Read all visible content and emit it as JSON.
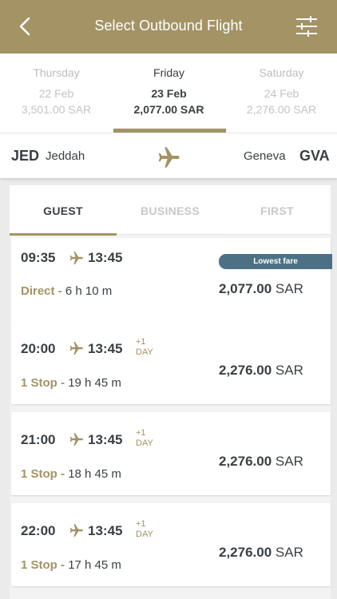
{
  "header": {
    "title": "Select Outbound Flight",
    "back_icon": "chevron-left-icon",
    "filter_icon": "sliders-icon"
  },
  "dates": [
    {
      "day": "Thursday",
      "date": "22 Feb",
      "price": "3,501.00 SAR",
      "selected": false
    },
    {
      "day": "Friday",
      "date": "23 Feb",
      "price": "2,077.00 SAR",
      "selected": true
    },
    {
      "day": "Saturday",
      "date": "24 Feb",
      "price": "2,276.00 SAR",
      "selected": false
    }
  ],
  "route": {
    "from_code": "JED",
    "from_city": "Jeddah",
    "to_city": "Geneva",
    "to_code": "GVA"
  },
  "tabs": [
    {
      "label": "GUEST",
      "selected": true
    },
    {
      "label": "BUSINESS",
      "selected": false
    },
    {
      "label": "FIRST",
      "selected": false
    }
  ],
  "flights": [
    {
      "dep": "09:35",
      "arr": "13:45",
      "plus_day": "",
      "stops": "Direct",
      "sep": "-",
      "duration": "6 h 10 m",
      "amount": "2,077.00",
      "currency": "SAR",
      "badge": "Lowest fare"
    },
    {
      "dep": "20:00",
      "arr": "13:45",
      "plus_day": "+1\nDAY",
      "stops": "1 Stop",
      "sep": "-",
      "duration": "19 h 45 m",
      "amount": "2,276.00",
      "currency": "SAR",
      "badge": ""
    },
    {
      "dep": "21:00",
      "arr": "13:45",
      "plus_day": "+1\nDAY",
      "stops": "1 Stop",
      "sep": "-",
      "duration": "18 h 45 m",
      "amount": "2,276.00",
      "currency": "SAR",
      "badge": ""
    },
    {
      "dep": "22:00",
      "arr": "13:45",
      "plus_day": "+1\nDAY",
      "stops": "1 Stop",
      "sep": "-",
      "duration": "17 h 45 m",
      "amount": "2,276.00",
      "currency": "SAR",
      "badge": ""
    }
  ],
  "colors": {
    "accent": "#a39365",
    "badge": "#4c7184",
    "text": "#3a3f44"
  }
}
